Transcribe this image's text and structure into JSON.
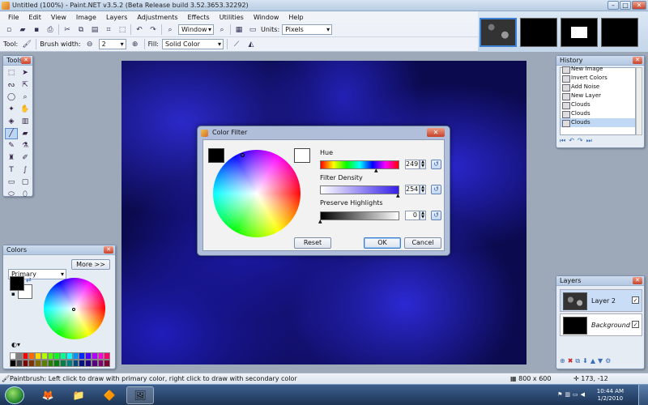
{
  "window": {
    "title": "Untitled (100%) - Paint.NET v3.5.2 (Beta Release build 3.52.3653.32292)"
  },
  "menu": [
    "File",
    "Edit",
    "View",
    "Image",
    "Layers",
    "Adjustments",
    "Effects",
    "Utilities",
    "Window",
    "Help"
  ],
  "toolbar": {
    "zoom_select": "Window",
    "units_label": "Units:",
    "units_value": "Pixels"
  },
  "toolbar2": {
    "tool_label": "Tool:",
    "brush_width_label": "Brush width:",
    "brush_width_value": "2",
    "fill_label": "Fill:",
    "fill_value": "Solid Color"
  },
  "tools_panel": {
    "title": "Tools"
  },
  "colors_panel": {
    "title": "Colors",
    "mode": "Primary",
    "more_button": "More >>"
  },
  "history_panel": {
    "title": "History",
    "items": [
      "New Image",
      "Invert Colors",
      "Add Noise",
      "New Layer",
      "Clouds",
      "Clouds",
      "Clouds"
    ],
    "selected_index": 6
  },
  "layers_panel": {
    "title": "Layers",
    "layers": [
      {
        "name": "Layer 2",
        "visible": true,
        "selected": true
      },
      {
        "name": "Background",
        "visible": true,
        "selected": false
      }
    ]
  },
  "dialog": {
    "title": "Color Filter",
    "hue_label": "Hue",
    "hue_value": "249",
    "density_label": "Filter Density",
    "density_value": "254",
    "highlights_label": "Preserve Highlights",
    "highlights_value": "0",
    "reset_button": "Reset",
    "ok_button": "OK",
    "cancel_button": "Cancel"
  },
  "status": {
    "hint": "Paintbrush: Left click to draw with primary color, right click to draw with secondary color",
    "size": "800 x 600",
    "coords": "173, -12"
  },
  "taskbar": {
    "time": "10:44 AM",
    "date": "1/2/2010"
  },
  "palette_colors": [
    "#ffffff",
    "#808080",
    "#ff0000",
    "#ff6a00",
    "#ffd800",
    "#b6ff00",
    "#4cff00",
    "#00ff21",
    "#00ff90",
    "#00ffff",
    "#0094ff",
    "#0026ff",
    "#4800ff",
    "#b200ff",
    "#ff00dc",
    "#ff006e",
    "#000000",
    "#404040",
    "#7f0000",
    "#7f3300",
    "#7f6a00",
    "#5b7f00",
    "#267f00",
    "#007f0e",
    "#007f46",
    "#007f7f",
    "#004a7f",
    "#00137f",
    "#21007f",
    "#57007f",
    "#7f006e",
    "#7f0037"
  ]
}
